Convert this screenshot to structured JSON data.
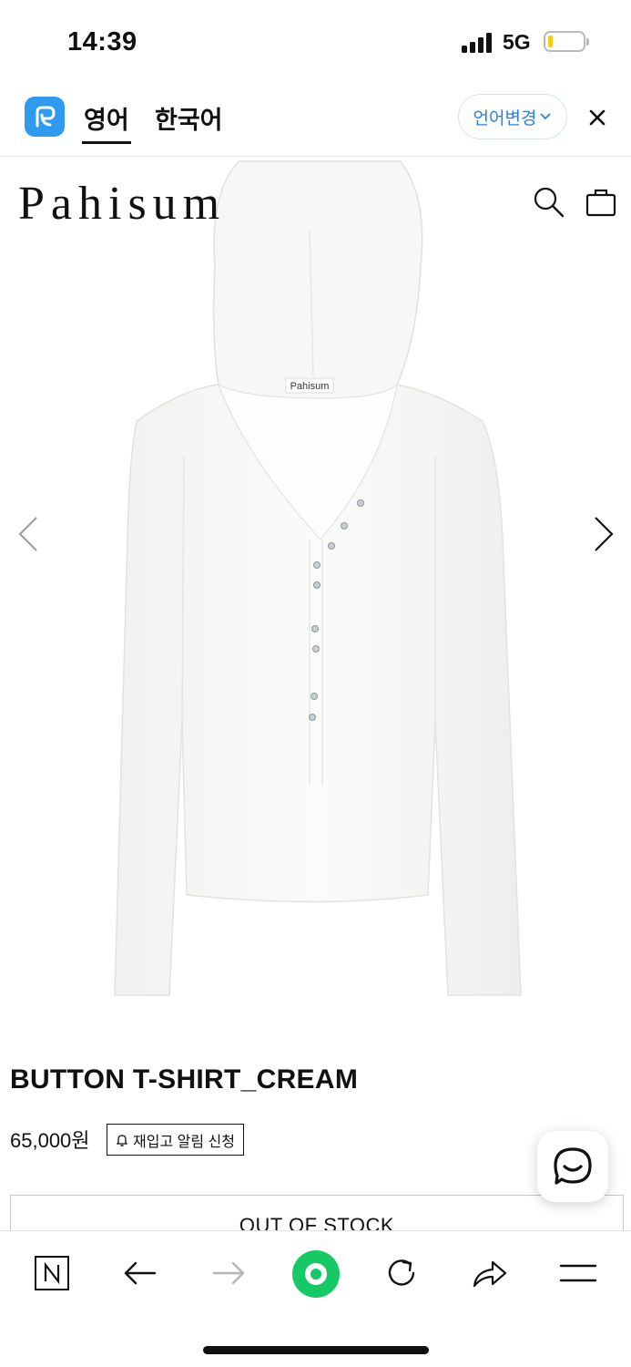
{
  "status_bar": {
    "time": "14:39",
    "network": "5G",
    "battery_level": 0.15,
    "battery_color": "#f6cd16"
  },
  "translate_bar": {
    "logo_icon": "papago-icon",
    "tabs": [
      {
        "label": "영어",
        "active": true
      },
      {
        "label": "한국어",
        "active": false
      }
    ],
    "change_language_label": "언어변경",
    "close_icon": "close-icon",
    "accent_color": "#2a7fe3"
  },
  "site_header": {
    "brand": "Pahisum",
    "search_icon": "search-icon",
    "cart_icon": "shopping-bag-icon"
  },
  "product_image": {
    "description_icon": "white-hooded-henley-shirt",
    "label_text": "Pahisum",
    "prev_icon": "chevron-left-icon",
    "next_icon": "chevron-right-icon"
  },
  "product": {
    "name": "BUTTON T-SHIRT_CREAM",
    "price": "65,000원",
    "restock_label": "재입고 알림 신청",
    "restock_icon": "bell-icon",
    "stock_button_label": "OUT OF STOCK"
  },
  "chat": {
    "icon": "chat-bubble-icon"
  },
  "bottom_bar": {
    "items": [
      {
        "icon": "naver-n-icon"
      },
      {
        "icon": "back-arrow-icon"
      },
      {
        "icon": "forward-arrow-icon"
      },
      {
        "icon": "green-home-dot-icon"
      },
      {
        "icon": "reload-icon"
      },
      {
        "icon": "share-icon"
      },
      {
        "icon": "menu-icon"
      }
    ],
    "accent_color": "#15c964"
  }
}
